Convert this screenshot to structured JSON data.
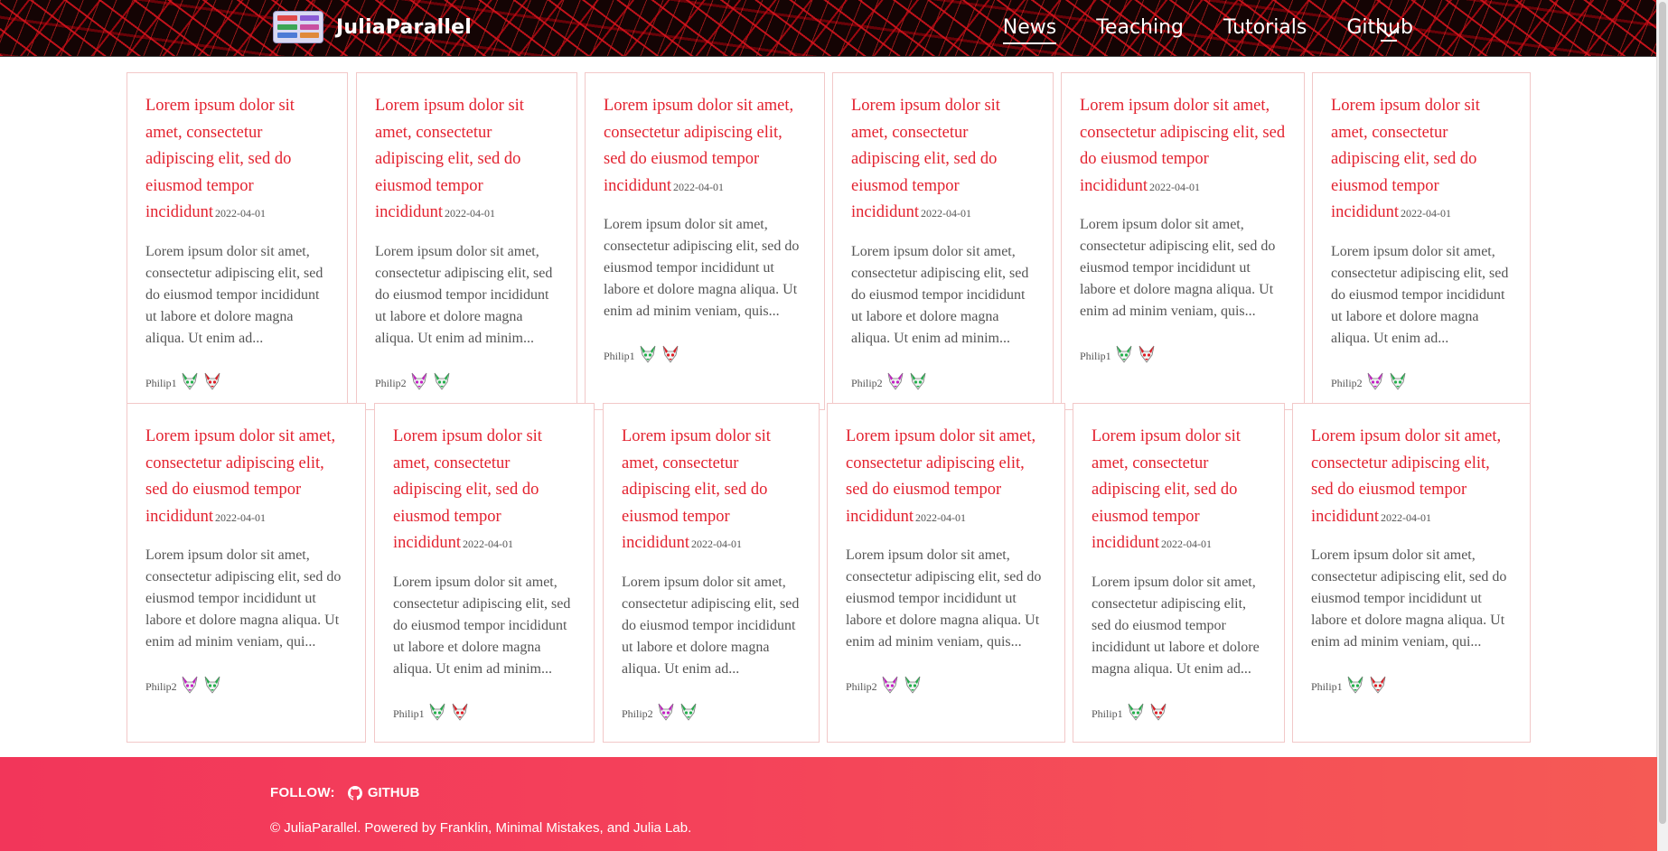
{
  "header": {
    "site_title": "JuliaParallel",
    "nav": [
      {
        "label": "News"
      },
      {
        "label": "Teaching"
      },
      {
        "label": "Tutorials"
      },
      {
        "label": "Github"
      }
    ],
    "logo_colors": [
      "#e04a4a",
      "#8a5bd6",
      "#3aa655",
      "#c94fa0",
      "#4d7bd6",
      "#e08a3a",
      "#3ab0b0",
      "#d05050"
    ]
  },
  "avatar_colors": {
    "philip1": [
      "#22b04b",
      "#e01b24"
    ],
    "philip2": [
      "#c51fc5",
      "#22b04b"
    ]
  },
  "cards": [
    {
      "title": "Lorem ipsum dolor sit amet, consectetur adipiscing elit, sed do eiusmod tempor incididunt",
      "date": "2022-04-01",
      "excerpt": "Lorem ipsum dolor sit amet, consectetur adipiscing elit, sed do eiusmod tempor incididunt ut labore et dolore magna aliqua. Ut enim ad...",
      "author": "Philip1"
    },
    {
      "title": "Lorem ipsum dolor sit amet, consectetur adipiscing elit, sed do eiusmod tempor incididunt",
      "date": "2022-04-01",
      "excerpt": "Lorem ipsum dolor sit amet, consectetur adipiscing elit, sed do eiusmod tempor incididunt ut labore et dolore magna aliqua. Ut enim ad minim...",
      "author": "Philip2"
    },
    {
      "title": "Lorem ipsum dolor sit amet, consectetur adipiscing elit, sed do eiusmod tempor incididunt",
      "date": "2022-04-01",
      "excerpt": "Lorem ipsum dolor sit amet, consectetur adipiscing elit, sed do eiusmod tempor incididunt ut labore et dolore magna aliqua. Ut enim ad minim veniam, quis...",
      "author": "Philip1"
    },
    {
      "title": "Lorem ipsum dolor sit amet, consectetur adipiscing elit, sed do eiusmod tempor incididunt",
      "date": "2022-04-01",
      "excerpt": "Lorem ipsum dolor sit amet, consectetur adipiscing elit, sed do eiusmod tempor incididunt ut labore et dolore magna aliqua. Ut enim ad minim...",
      "author": "Philip2"
    },
    {
      "title": "Lorem ipsum dolor sit amet, consectetur adipiscing elit, sed do eiusmod tempor incididunt",
      "date": "2022-04-01",
      "excerpt": "Lorem ipsum dolor sit amet, consectetur adipiscing elit, sed do eiusmod tempor incididunt ut labore et dolore magna aliqua. Ut enim ad minim veniam, quis...",
      "author": "Philip1"
    },
    {
      "title": "Lorem ipsum dolor sit amet, consectetur adipiscing elit, sed do eiusmod tempor incididunt",
      "date": "2022-04-01",
      "excerpt": "Lorem ipsum dolor sit amet, consectetur adipiscing elit, sed do eiusmod tempor incididunt ut labore et dolore magna aliqua. Ut enim ad...",
      "author": "Philip2"
    },
    {
      "title": "Lorem ipsum dolor sit amet, consectetur adipiscing elit, sed do eiusmod tempor incididunt",
      "date": "2022-04-01",
      "excerpt": "Lorem ipsum dolor sit amet, consectetur adipiscing elit, sed do eiusmod tempor incididunt ut labore et dolore magna aliqua. Ut enim ad minim veniam, qui...",
      "author": "Philip2"
    },
    {
      "title": "Lorem ipsum dolor sit amet, consectetur adipiscing elit, sed do eiusmod tempor incididunt",
      "date": "2022-04-01",
      "excerpt": "Lorem ipsum dolor sit amet, consectetur adipiscing elit, sed do eiusmod tempor incididunt ut labore et dolore magna aliqua. Ut enim ad minim...",
      "author": "Philip1"
    },
    {
      "title": "Lorem ipsum dolor sit amet, consectetur adipiscing elit, sed do eiusmod tempor incididunt",
      "date": "2022-04-01",
      "excerpt": "Lorem ipsum dolor sit amet, consectetur adipiscing elit, sed do eiusmod tempor incididunt ut labore et dolore magna aliqua. Ut enim ad...",
      "author": "Philip2"
    },
    {
      "title": "Lorem ipsum dolor sit amet, consectetur adipiscing elit, sed do eiusmod tempor incididunt",
      "date": "2022-04-01",
      "excerpt": "Lorem ipsum dolor sit amet, consectetur adipiscing elit, sed do eiusmod tempor incididunt ut labore et dolore magna aliqua. Ut enim ad minim veniam, quis...",
      "author": "Philip2"
    },
    {
      "title": "Lorem ipsum dolor sit amet, consectetur adipiscing elit, sed do eiusmod tempor incididunt",
      "date": "2022-04-01",
      "excerpt": "Lorem ipsum dolor sit amet, consectetur adipiscing elit, sed do eiusmod tempor incididunt ut labore et dolore magna aliqua. Ut enim ad...",
      "author": "Philip1"
    },
    {
      "title": "Lorem ipsum dolor sit amet, consectetur adipiscing elit, sed do eiusmod tempor incididunt",
      "date": "2022-04-01",
      "excerpt": "Lorem ipsum dolor sit amet, consectetur adipiscing elit, sed do eiusmod tempor incididunt ut labore et dolore magna aliqua. Ut enim ad minim veniam, qui...",
      "author": "Philip1"
    }
  ],
  "footer": {
    "follow_label": "FOLLOW:",
    "github_label": "GITHUB",
    "copyright": "© JuliaParallel. Powered by Franklin, Minimal Mistakes, and Julia Lab."
  }
}
